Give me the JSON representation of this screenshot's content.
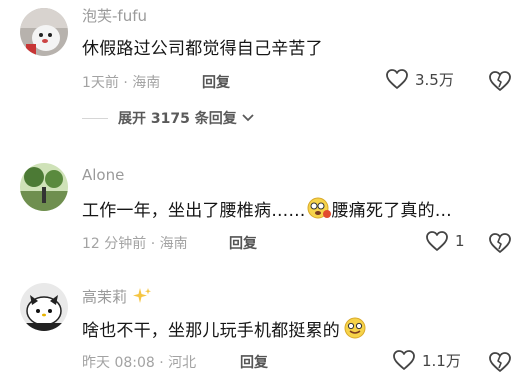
{
  "comments": [
    {
      "username": "泡芙-fufu",
      "text": "休假路过公司都觉得自己辛苦了",
      "meta": "1天前 · 海南",
      "reply_label": "回复",
      "likes": "3.5万"
    },
    {
      "username": "Alone",
      "text_before": "工作一年，坐出了腰椎病……",
      "text_after": "腰痛死了真的…",
      "meta": "12 分钟前 · 海南",
      "reply_label": "回复",
      "likes": "1"
    },
    {
      "username": "高茉莉",
      "text": "啥也不干，坐那儿玩手机都挺累的",
      "meta": "昨天 08:08 · 河北",
      "reply_label": "回复",
      "likes": "1.1万"
    }
  ],
  "expand_replies": {
    "label": "展开 3175 条回复"
  },
  "icons": {
    "like": "heart-outline-icon",
    "dislike": "broken-heart-icon",
    "expand": "chevron-down-icon",
    "sparkle": "sparkles-icon",
    "emoji1": "dizzy-face-emoji",
    "emoji2": "smile-emoji"
  }
}
